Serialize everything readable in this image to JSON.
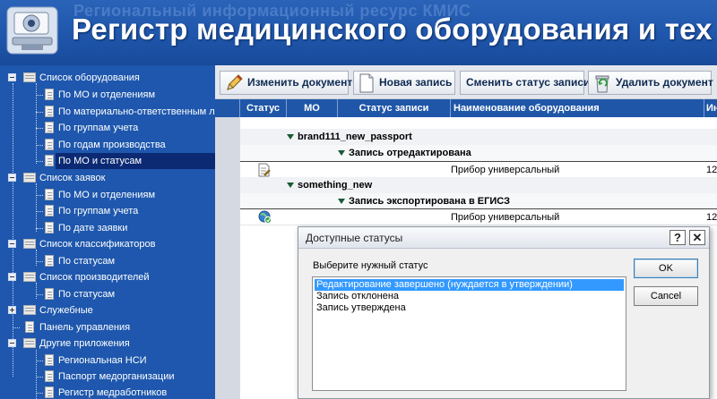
{
  "header": {
    "subtitle": "Региональный информационный ресурс КМИС",
    "title": "Регистр медицинского оборудования и тех"
  },
  "sidebar": {
    "items": [
      {
        "label": "Список оборудования",
        "level": 0,
        "type": "folder",
        "toggle": "minus"
      },
      {
        "label": "По МО и отделениям",
        "level": 1,
        "type": "doc"
      },
      {
        "label": "По материально-ответственным л",
        "level": 1,
        "type": "doc"
      },
      {
        "label": "По группам учета",
        "level": 1,
        "type": "doc"
      },
      {
        "label": "По годам производства",
        "level": 1,
        "type": "doc"
      },
      {
        "label": "По МО и статусам",
        "level": 1,
        "type": "doc",
        "selected": true
      },
      {
        "label": "Список заявок",
        "level": 0,
        "type": "folder",
        "toggle": "minus"
      },
      {
        "label": "По МО и отделениям",
        "level": 1,
        "type": "doc"
      },
      {
        "label": "По группам учета",
        "level": 1,
        "type": "doc"
      },
      {
        "label": "По дате заявки",
        "level": 1,
        "type": "doc"
      },
      {
        "label": "Список классификаторов",
        "level": 0,
        "type": "folder",
        "toggle": "minus"
      },
      {
        "label": "По статусам",
        "level": 1,
        "type": "doc"
      },
      {
        "label": "Список производителей",
        "level": 0,
        "type": "folder",
        "toggle": "minus"
      },
      {
        "label": "По статусам",
        "level": 1,
        "type": "doc"
      },
      {
        "label": "Служебные",
        "level": 0,
        "type": "folder",
        "toggle": "plus"
      },
      {
        "label": "Панель управления",
        "level": 0,
        "type": "doc"
      },
      {
        "label": "Другие приложения",
        "level": 0,
        "type": "folder",
        "toggle": "minus"
      },
      {
        "label": "Региональная НСИ",
        "level": 1,
        "type": "doc"
      },
      {
        "label": "Паспорт медорганизации",
        "level": 1,
        "type": "doc"
      },
      {
        "label": "Регистр медработников",
        "level": 1,
        "type": "doc"
      }
    ]
  },
  "toolbar": {
    "edit_label": "Изменить документ",
    "new_label": "Новая запись",
    "change_status_label": "Сменить статус записи",
    "delete_label": "Удалить документ"
  },
  "grid": {
    "columns": [
      "Статус",
      "МО",
      "Статус записи",
      "Наименование оборудования",
      "Ин"
    ],
    "groups": [
      {
        "mo": "brand111_new_passport",
        "status": "Запись отредактирована",
        "row": {
          "status_icon": "edit-doc-icon",
          "name": "Прибор универсальный",
          "code": "12"
        }
      },
      {
        "mo": "something_new",
        "status": "Запись экспортирована в ЕГИСЗ",
        "row": {
          "status_icon": "export-globe-icon",
          "name": "Прибор универсальный",
          "code": "12"
        }
      }
    ]
  },
  "dialog": {
    "title": "Доступные статусы",
    "help_label": "?",
    "close_label": "✕",
    "prompt": "Выберите нужный статус",
    "options": [
      "Редактирование завершено (нуждается в утверждении)",
      "Запись отклонена",
      "Запись утверждена"
    ],
    "selected_index": 0,
    "ok_label": "OK",
    "cancel_label": "Cancel"
  }
}
